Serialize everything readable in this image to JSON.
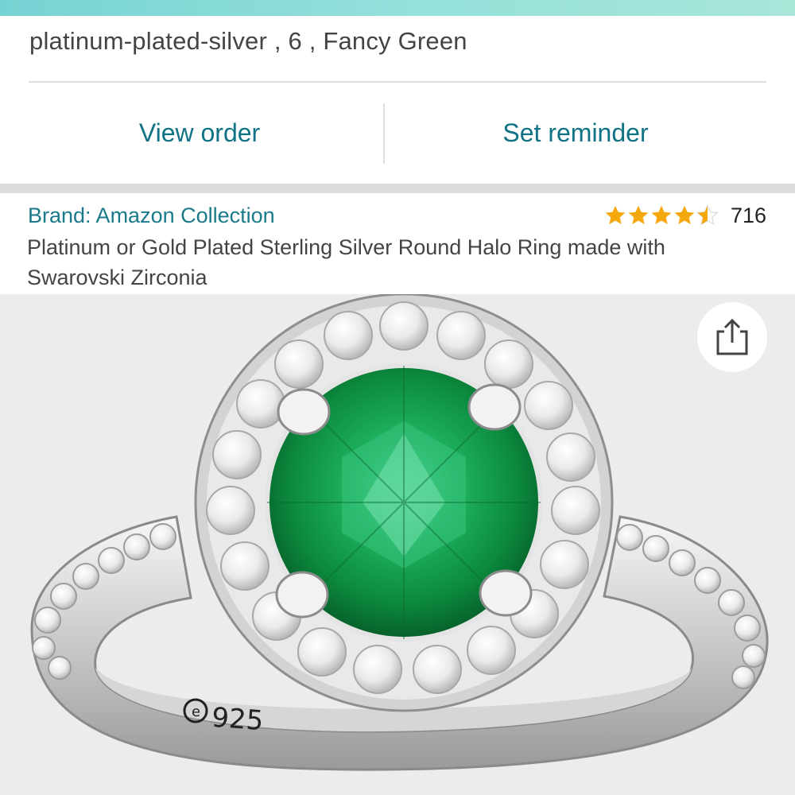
{
  "order": {
    "variant_text": "platinum-plated-silver , 6 , Fancy Green",
    "view_order_label": "View order",
    "set_reminder_label": "Set reminder"
  },
  "product": {
    "brand_label": "Brand: Amazon Collection",
    "rating": 4.5,
    "review_count": "716",
    "title": "Platinum or Gold Plated Sterling Silver Round Halo Ring made with Swarovski Zirconia",
    "image_engraving": "925"
  },
  "colors": {
    "accent": "#0f7385",
    "brand_link": "#1a7a8a",
    "star": "#f4a80c",
    "gem": "#13a44f"
  },
  "icons": {
    "share": "share-icon",
    "star": "star-icon"
  }
}
